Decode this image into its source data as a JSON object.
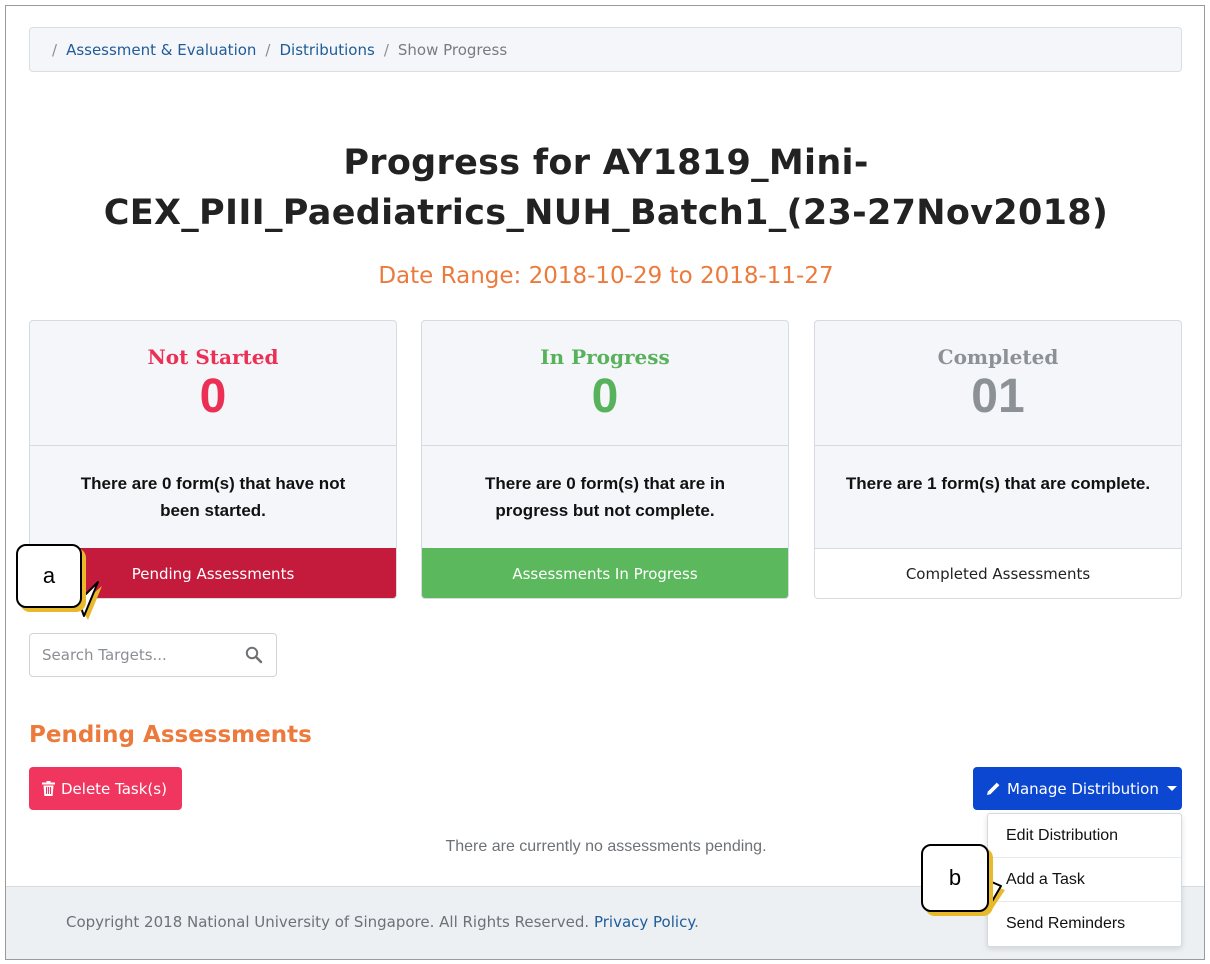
{
  "breadcrumb": {
    "items": [
      "Assessment & Evaluation",
      "Distributions"
    ],
    "current": "Show Progress"
  },
  "page": {
    "title_line1": "Progress for AY1819_Mini-",
    "title_line2": "CEX_PIII_Paediatrics_NUH_Batch1_(23-27Nov2018)",
    "date_range": "Date Range: 2018-10-29 to 2018-11-27"
  },
  "cards": [
    {
      "label": "Not Started",
      "count": "0",
      "description": "There are 0 form(s) that have not been started.",
      "button": "Pending Assessments",
      "color": "#ec2f55",
      "button_color": "#c41b3c"
    },
    {
      "label": "In Progress",
      "count": "0",
      "description": "There are 0 form(s) that are in progress but not complete.",
      "button": "Assessments In Progress",
      "color": "#58b15b",
      "button_color": "#5cb85c"
    },
    {
      "label": "Completed",
      "count": "01",
      "description": "There are 1 form(s) that are complete.",
      "button": "Completed Assessments",
      "color": "#8c9196",
      "button_color": "#ffffff"
    }
  ],
  "search": {
    "placeholder": "Search Targets...",
    "value": "",
    "icon": "search-icon"
  },
  "section": {
    "title": "Pending Assessments",
    "delete_label": "Delete Task(s)",
    "delete_icon": "trash-icon",
    "manage_label": "Manage Distribution",
    "manage_icon": "pencil-icon",
    "empty_message": "There are currently no assessments pending."
  },
  "dropdown": {
    "items": [
      "Edit Distribution",
      "Add a Task",
      "Send Reminders"
    ]
  },
  "footer": {
    "copyright": "Copyright 2018 National University of Singapore. All Rights Reserved.",
    "link": "Privacy Policy",
    "period": "."
  },
  "callouts": {
    "a": "a",
    "b": "b"
  },
  "colors": {
    "accent_orange": "#ec7a3c",
    "danger": "#f0365e",
    "primary": "#0b47d1",
    "callout_shadow": "#e8b92a"
  }
}
